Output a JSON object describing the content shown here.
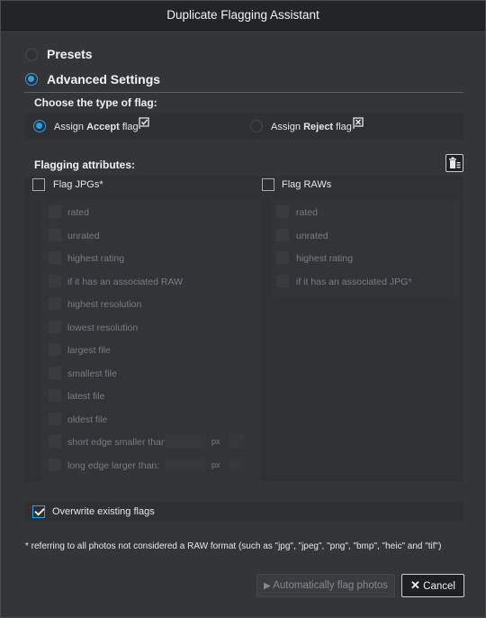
{
  "window": {
    "title": "Duplicate Flagging Assistant"
  },
  "mode": {
    "presets_label": "Presets",
    "advanced_label": "Advanced Settings",
    "selected": "Advanced Settings"
  },
  "flag_type": {
    "heading": "Choose the type of flag:",
    "accept": {
      "prefix": "Assign ",
      "bold": "Accept",
      "suffix": " flag",
      "selected": true
    },
    "reject": {
      "prefix": "Assign ",
      "bold": "Reject",
      "suffix": " flag",
      "selected": false
    }
  },
  "attributes": {
    "heading": "Flagging attributes:",
    "jpg": {
      "label": "Flag JPGs*",
      "checked": false,
      "options": [
        "rated",
        "unrated",
        "highest rating",
        "if it has an associated RAW",
        "highest resolution",
        "lowest resolution",
        "largest file",
        "smallest file",
        "latest file",
        "oldest file",
        "short edge smaller than:",
        "long edge larger than:"
      ],
      "short_edge_unit": "px",
      "long_edge_unit": "px"
    },
    "raw": {
      "label": "Flag RAWs",
      "checked": false,
      "options": [
        "rated",
        "unrated",
        "highest rating",
        "if it has an associated JPG*"
      ]
    }
  },
  "overwrite": {
    "label": "Overwrite existing flags",
    "checked": true
  },
  "footnote": "* referring to all photos not considered a RAW format (such as \"jpg\", \"jpeg\", \"png\", \"bmp\", \"heic\" and \"tif\")",
  "buttons": {
    "auto": "Automatically flag photos",
    "cancel": "Cancel"
  },
  "colors": {
    "accent": "#2f9ee3",
    "background": "#333539",
    "titlebar": "#232427"
  }
}
